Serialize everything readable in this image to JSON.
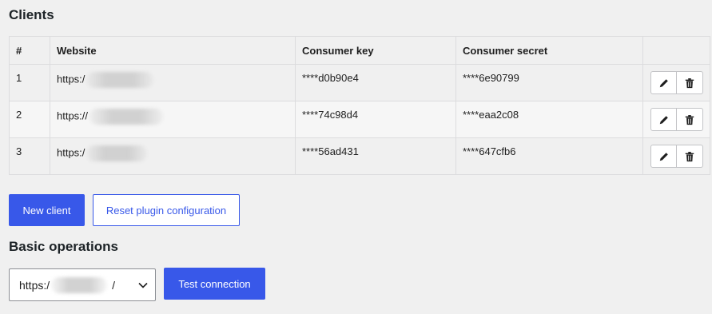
{
  "clients_section": {
    "heading": "Clients",
    "columns": [
      "#",
      "Website",
      "Consumer key",
      "Consumer secret",
      ""
    ],
    "rows": [
      {
        "num": "1",
        "website": "https:/",
        "consumer_key": "****d0b90e4",
        "consumer_secret": "****6e90799"
      },
      {
        "num": "2",
        "website": "https://",
        "consumer_key": "****74c98d4",
        "consumer_secret": "****eaa2c08"
      },
      {
        "num": "3",
        "website": "https:/",
        "consumer_key": "****56ad431",
        "consumer_secret": "****647cfb6"
      }
    ],
    "new_client_label": "New client",
    "reset_label": "Reset plugin configuration"
  },
  "operations_section": {
    "heading": "Basic operations",
    "site_select_prefix": "https:/",
    "site_select_suffix": "/",
    "test_connection_label": "Test connection"
  },
  "colors": {
    "primary": "#3858e9",
    "background": "#f0f0f0",
    "border": "#dcdcde"
  }
}
